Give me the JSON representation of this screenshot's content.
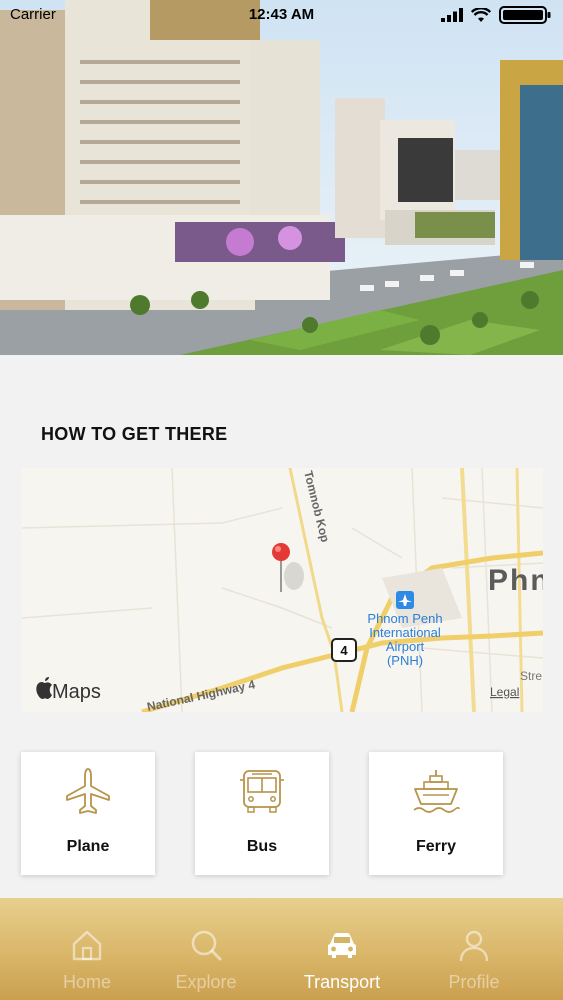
{
  "status_bar": {
    "carrier": "Carrier",
    "time": "12:43 AM"
  },
  "section": {
    "title": "HOW TO GET THERE"
  },
  "map": {
    "road_label_1": "Tomnob Kop",
    "road_label_2": "National Highway 4",
    "highway_shield": "4",
    "airport_label_1": "Phnom Penh",
    "airport_label_2": "International",
    "airport_label_3": "Airport",
    "airport_label_4": "(PNH)",
    "city_label": "Phn",
    "street_partial": "Stre",
    "maps_brand": "Maps",
    "legal": "Legal"
  },
  "transport_options": [
    {
      "label": "Plane",
      "icon": "plane-icon"
    },
    {
      "label": "Bus",
      "icon": "bus-icon"
    },
    {
      "label": "Ferry",
      "icon": "ferry-icon"
    }
  ],
  "tab_bar": {
    "items": [
      {
        "label": "Home",
        "icon": "home-icon",
        "active": false
      },
      {
        "label": "Explore",
        "icon": "search-icon",
        "active": false
      },
      {
        "label": "Transport",
        "icon": "car-icon",
        "active": true
      },
      {
        "label": "Profile",
        "icon": "profile-icon",
        "active": false
      }
    ]
  },
  "colors": {
    "accent_gold": "#b8934a",
    "tab_gradient_top": "#e8cf8e",
    "tab_gradient_bottom": "#caa04f",
    "pin_red": "#e53935"
  }
}
